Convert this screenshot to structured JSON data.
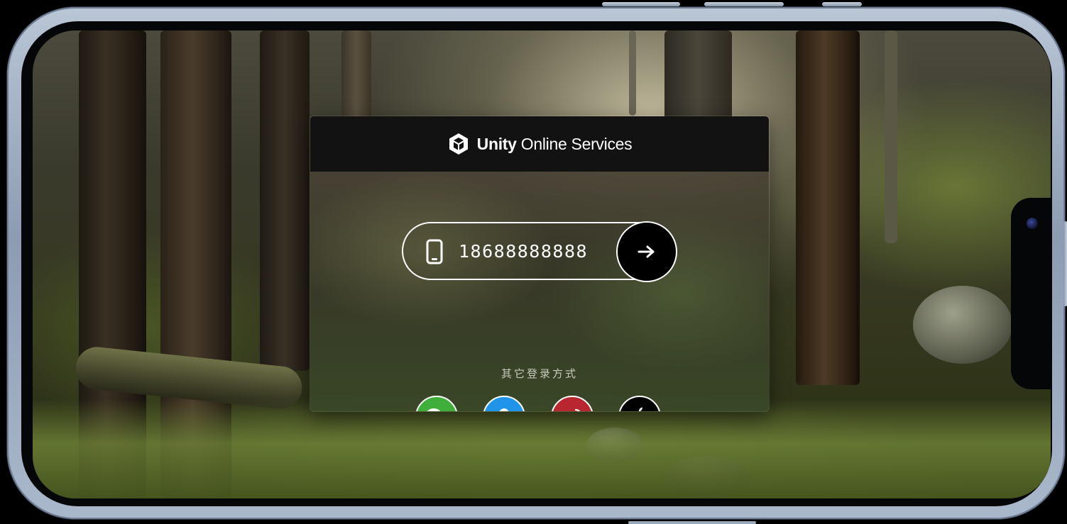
{
  "brand": {
    "strong": "Unity",
    "light": "Online Services",
    "logo_icon": "unity-cube-icon"
  },
  "login": {
    "phone_value": "18688888888",
    "phone_icon": "smartphone-icon",
    "submit_icon": "arrow-right-icon"
  },
  "other_methods": {
    "label": "其它登录方式",
    "providers": [
      {
        "name": "wechat",
        "icon": "wechat-icon",
        "color": "#3fae3a"
      },
      {
        "name": "qq",
        "icon": "qq-penguin-icon",
        "color": "#1f94e8"
      },
      {
        "name": "weibo",
        "icon": "weibo-icon",
        "color": "#b8262f"
      },
      {
        "name": "apple",
        "icon": "apple-icon",
        "color": "#000000"
      }
    ]
  }
}
